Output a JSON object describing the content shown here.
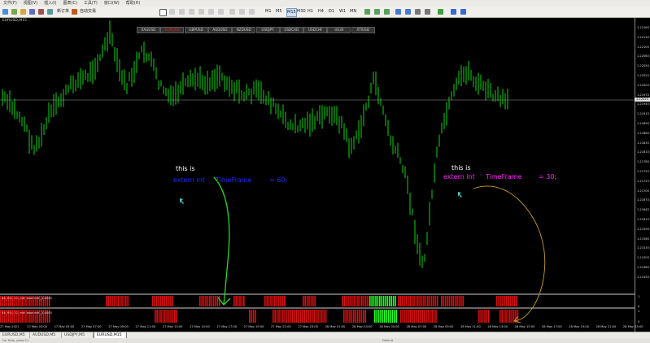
{
  "menu": [
    "文件(F)",
    "视图(V)",
    "插入(I)",
    "图表(C)",
    "工具(T)",
    "窗口(W)",
    "帮助(H)"
  ],
  "toolbar": {
    "new_order_label": "新订单",
    "autotrade_label": "自动交易",
    "timeframes": [
      "M1",
      "M5",
      "M15",
      "M30",
      "H1",
      "H4",
      "D1",
      "W1",
      "MN"
    ]
  },
  "chart": {
    "symbol_label": "EURUSD,M15",
    "pair_buttons": [
      "XAUUSD",
      "EURUSD",
      "GBPUSD",
      "AUDUSD",
      "NZDUSD",
      "USDJPY",
      "USDCAD",
      "USDCHF",
      "US30",
      "XTIUSD"
    ],
    "active_pair": "EURUSD",
    "current_price": "1.22025",
    "price_ticks": [
      "1.22160",
      "1.22130",
      "1.22105",
      "1.22080",
      "1.22050",
      "1.22025",
      "1.22000",
      "1.21970",
      "1.21945",
      "1.21915",
      "1.21890",
      "1.21860",
      "1.21835",
      "1.21810",
      "1.21780",
      "1.21755",
      "1.21725",
      "1.21700",
      "1.21670",
      "1.21645",
      "1.21615",
      "1.21590",
      "1.21560",
      "1.21535",
      "1.21505",
      "1.21480",
      "1.21450"
    ],
    "time_ticks": [
      "27 May 2021",
      "27 May 03:00",
      "27 May 05:00",
      "27 May 07:00",
      "27 May 09:00",
      "27 May 11:00",
      "27 May 13:00",
      "27 May 15:00",
      "27 May 17:00",
      "27 May 19:00",
      "27 May 21:00",
      "27 May 23:00",
      "28 May 01:00",
      "28 May 03:00",
      "28 May 05:00",
      "28 May 07:00",
      "28 May 09:00",
      "28 May 11:00",
      "28 May 13:00",
      "28 May 15:00",
      "28 May 17:00",
      "28 May 19:00",
      "28 May 21:00",
      "28 May 23:00"
    ]
  },
  "annotations": {
    "left": {
      "line1": "this is",
      "extern": "extern int",
      "tf": "TimeFrame",
      "value": "= 60;"
    },
    "right": {
      "line1": "this is",
      "extern": "extern int",
      "tf": "TimeFrame",
      "value": "= 30;"
    }
  },
  "indicators": [
    {
      "label": "BB_RSI_CCI_mtf: kaoz mtf _1.0000",
      "scale_top": "1",
      "scale_bottom": "0"
    },
    {
      "label": "BB_RSI_CCI_mtf: kaoz mtf _1.0000",
      "scale_top": "1",
      "scale_bottom": "0"
    }
  ],
  "tabs": [
    "EURUSD,M5",
    "AUDUSD,M5",
    "USDJPY,M5",
    "EURUSD,M15"
  ],
  "active_tab": "EURUSD,M15",
  "status": {
    "left": "For Help, press F1",
    "right": "Default"
  },
  "colors": {
    "candle": "#0bd60b",
    "indicator_red": "#d81010",
    "indicator_green": "#22ff22",
    "annot_left": "#1a2cff",
    "annot_right": "#ff20ff",
    "arrow_left": "#2bd62b",
    "arrow_right": "#c8a020"
  }
}
